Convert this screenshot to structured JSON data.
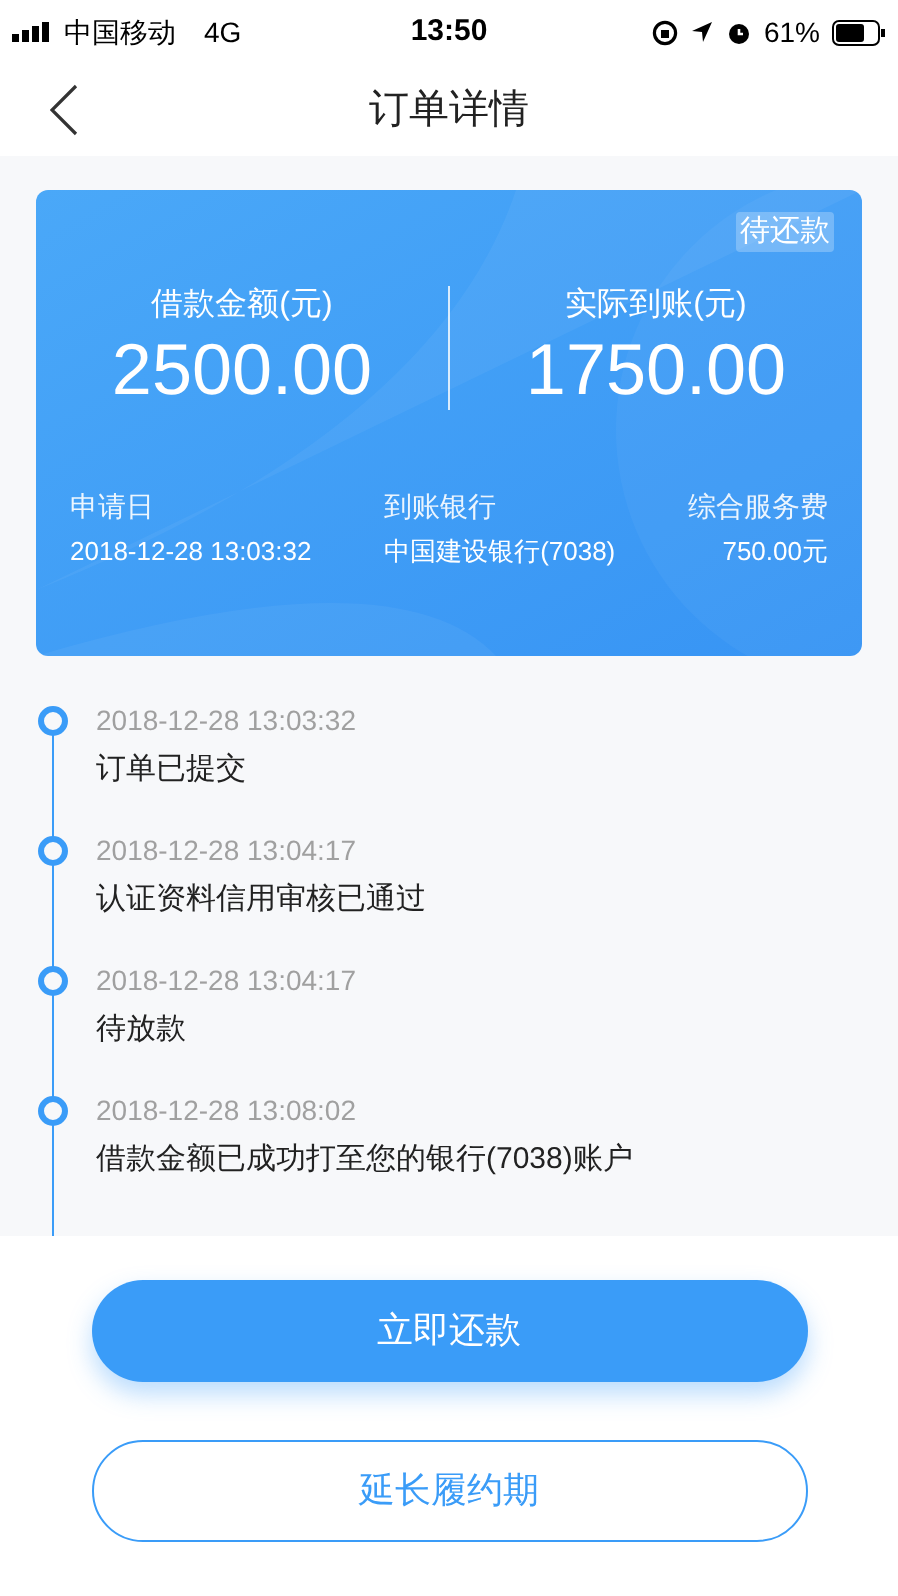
{
  "status_bar": {
    "carrier": "中国移动",
    "network": "4G",
    "time": "13:50",
    "battery": "61%"
  },
  "nav": {
    "title": "订单详情"
  },
  "card": {
    "status": "待还款",
    "amounts": [
      {
        "label": "借款金额(元)",
        "value": "2500.00"
      },
      {
        "label": "实际到账(元)",
        "value": "1750.00"
      }
    ],
    "details": [
      {
        "label": "申请日",
        "value": "2018-12-28 13:03:32"
      },
      {
        "label": "到账银行",
        "value": "中国建设银行(7038)"
      },
      {
        "label": "综合服务费",
        "value": "750.00元"
      }
    ]
  },
  "timeline": [
    {
      "time": "2018-12-28 13:03:32",
      "event": "订单已提交"
    },
    {
      "time": "2018-12-28 13:04:17",
      "event": "认证资料信用审核已通过"
    },
    {
      "time": "2018-12-28 13:04:17",
      "event": "待放款"
    },
    {
      "time": "2018-12-28 13:08:02",
      "event": "借款金额已成功打至您的银行(7038)账户"
    }
  ],
  "buttons": [
    {
      "label": "立即还款",
      "kind": "primary"
    },
    {
      "label": "延长履约期",
      "kind": "outline"
    }
  ]
}
